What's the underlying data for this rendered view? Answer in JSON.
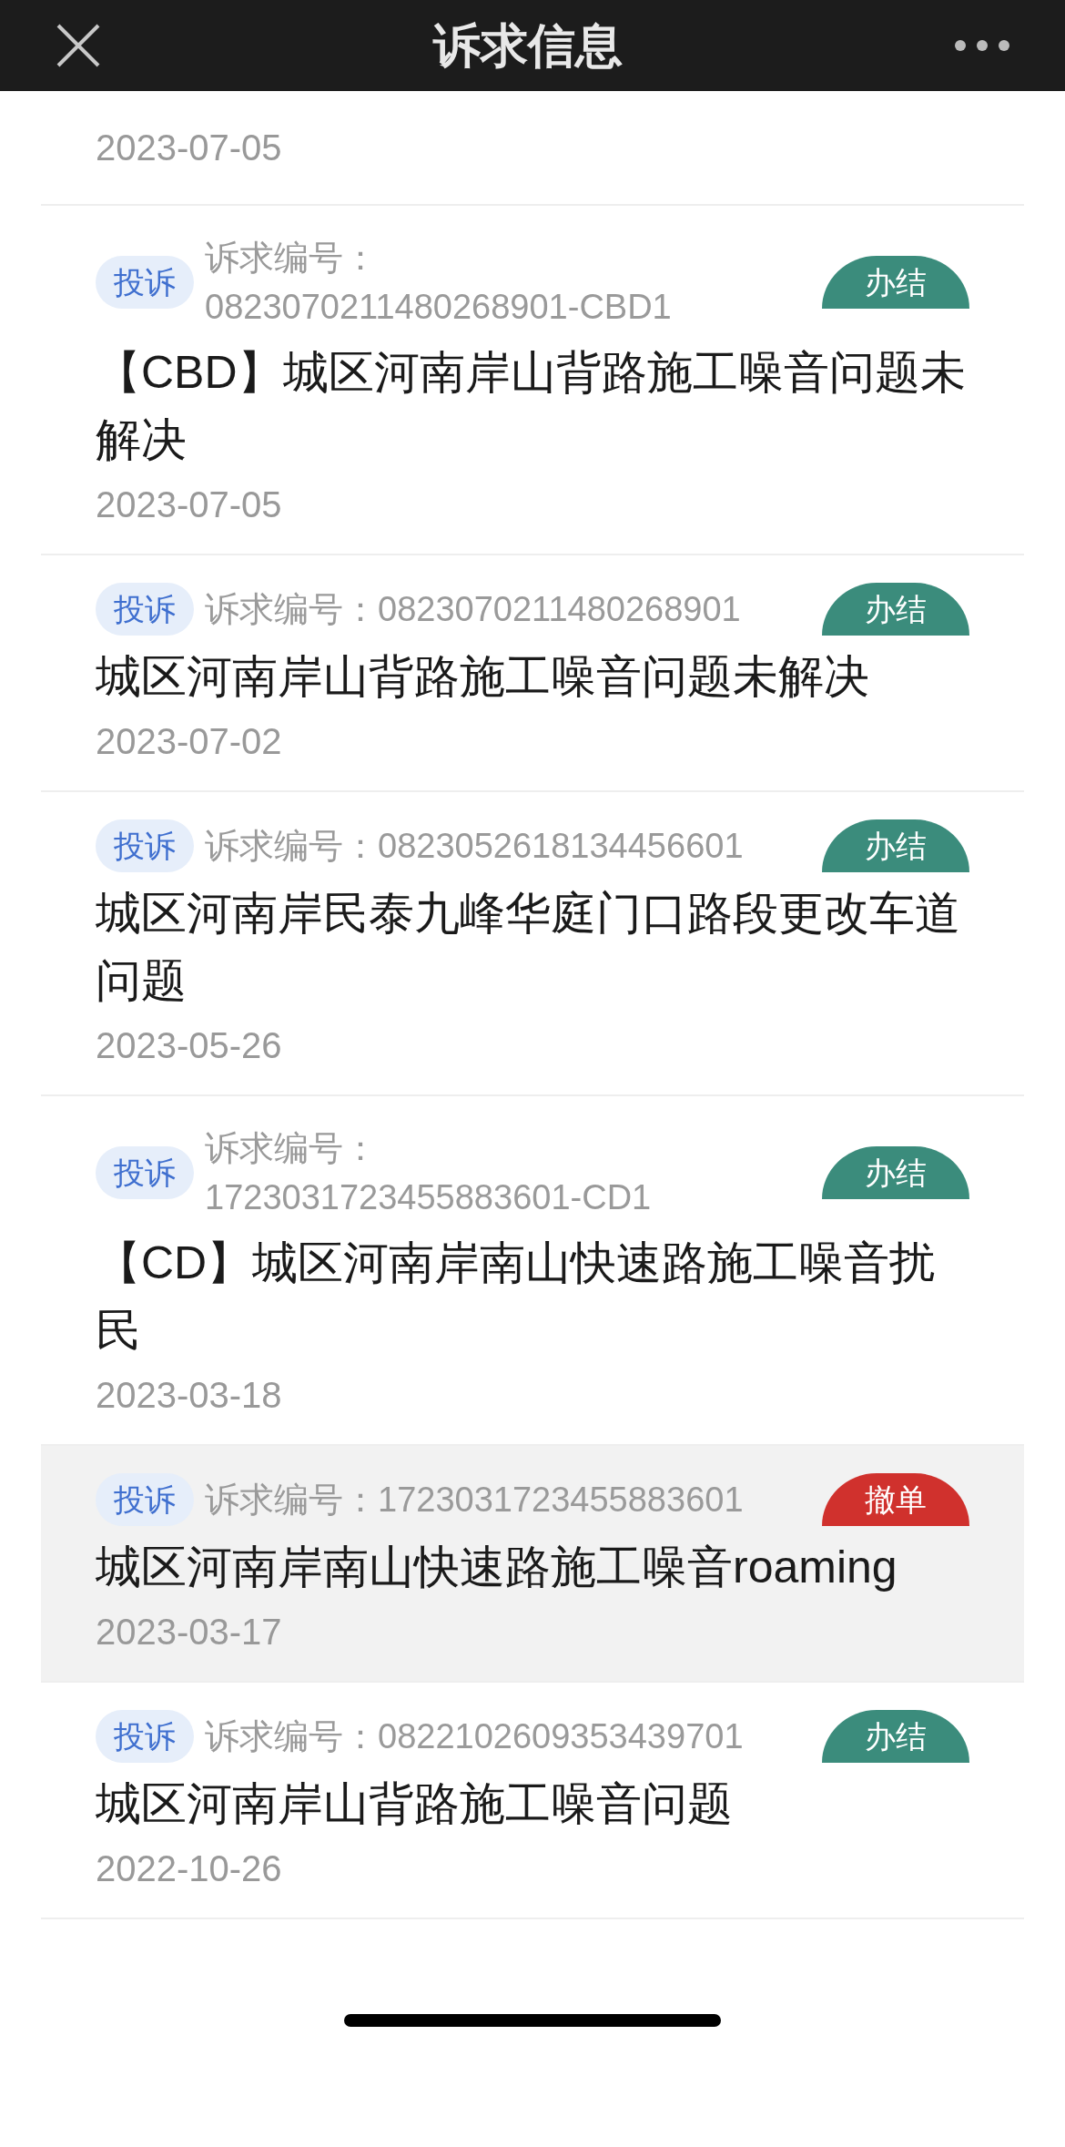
{
  "header": {
    "title": "诉求信息"
  },
  "partial_item": {
    "date": "2023-07-05"
  },
  "items": [
    {
      "type": "投诉",
      "number_label": "诉求编号：",
      "number": "0823070211480268901-CBD1",
      "status": "办结",
      "kind": "done",
      "title": "【CBD】城区河南岸山背路施工噪音问题未解决",
      "date": "2023-07-05",
      "selected": false
    },
    {
      "type": "投诉",
      "number_label": "诉求编号：",
      "number": "0823070211480268901",
      "status": "办结",
      "kind": "done",
      "title": "城区河南岸山背路施工噪音问题未解决",
      "date": "2023-07-02",
      "selected": false
    },
    {
      "type": "投诉",
      "number_label": "诉求编号：",
      "number": "0823052618134456601",
      "status": "办结",
      "kind": "done",
      "title": "城区河南岸民泰九峰华庭门口路段更改车道问题",
      "date": "2023-05-26",
      "selected": false
    },
    {
      "type": "投诉",
      "number_label": "诉求编号：",
      "number": "1723031723455883601-CD1",
      "status": "办结",
      "kind": "done",
      "title": "【CD】城区河南岸南山快速路施工噪音扰民",
      "date": "2023-03-18",
      "selected": false
    },
    {
      "type": "投诉",
      "number_label": "诉求编号：",
      "number": "1723031723455883601",
      "status": "撤单",
      "kind": "cancelled",
      "title": "城区河南岸南山快速路施工噪音roaming",
      "date": "2023-03-17",
      "selected": true
    },
    {
      "type": "投诉",
      "number_label": "诉求编号：",
      "number": "0822102609353439701",
      "status": "办结",
      "kind": "done",
      "title": "城区河南岸山背路施工噪音问题",
      "date": "2022-10-26",
      "selected": false
    }
  ]
}
